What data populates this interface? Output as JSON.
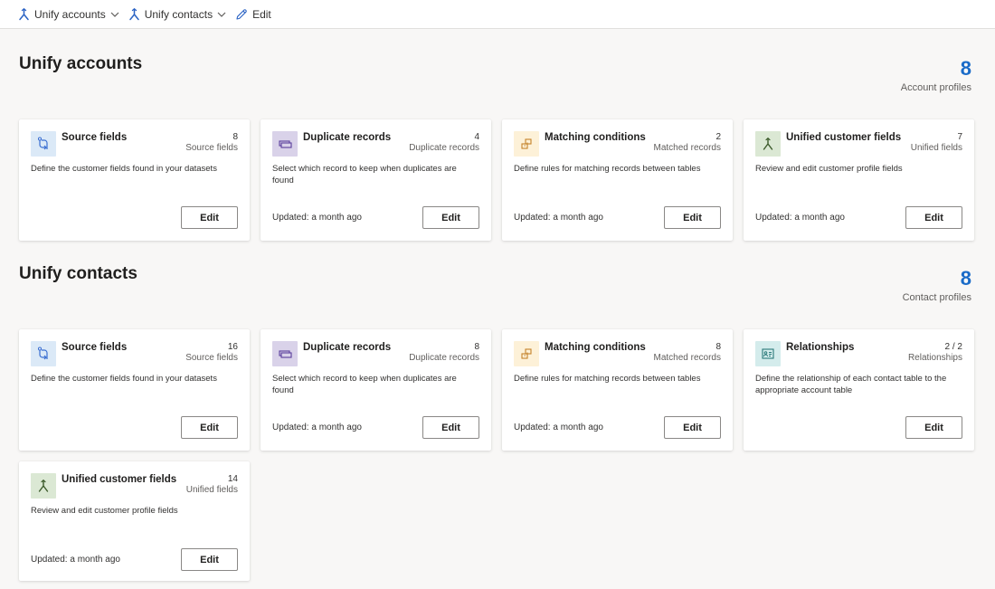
{
  "toolbar": {
    "unify_accounts": "Unify accounts",
    "unify_contacts": "Unify contacts",
    "edit": "Edit"
  },
  "accounts": {
    "title": "Unify accounts",
    "profiles_count": "8",
    "profiles_label": "Account profiles",
    "cards": [
      {
        "title": "Source fields",
        "count": "8",
        "unit": "Source fields",
        "desc": "Define the customer fields found in your datasets",
        "updated": "",
        "edit": "Edit",
        "icon": "source-fields-icon"
      },
      {
        "title": "Duplicate records",
        "count": "4",
        "unit": "Duplicate records",
        "desc": "Select which record to keep when duplicates are found",
        "updated": "Updated: a month ago",
        "edit": "Edit",
        "icon": "duplicate-records-icon"
      },
      {
        "title": "Matching conditions",
        "count": "2",
        "unit": "Matched records",
        "desc": "Define rules for matching records between tables",
        "updated": "Updated: a month ago",
        "edit": "Edit",
        "icon": "matching-conditions-icon"
      },
      {
        "title": "Unified customer fields",
        "count": "7",
        "unit": "Unified fields",
        "desc": "Review and edit customer profile fields",
        "updated": "Updated: a month ago",
        "edit": "Edit",
        "icon": "unified-fields-icon"
      }
    ]
  },
  "contacts": {
    "title": "Unify contacts",
    "profiles_count": "8",
    "profiles_label": "Contact profiles",
    "cards": [
      {
        "title": "Source fields",
        "count": "16",
        "unit": "Source fields",
        "desc": "Define the customer fields found in your datasets",
        "updated": "",
        "edit": "Edit",
        "icon": "source-fields-icon"
      },
      {
        "title": "Duplicate records",
        "count": "8",
        "unit": "Duplicate records",
        "desc": "Select which record to keep when duplicates are found",
        "updated": "Updated: a month ago",
        "edit": "Edit",
        "icon": "duplicate-records-icon"
      },
      {
        "title": "Matching conditions",
        "count": "8",
        "unit": "Matched records",
        "desc": "Define rules for matching records between tables",
        "updated": "Updated: a month ago",
        "edit": "Edit",
        "icon": "matching-conditions-icon"
      },
      {
        "title": "Relationships",
        "count": "2 / 2",
        "unit": "Relationships",
        "desc": "Define the relationship of each contact table to the appropriate account table",
        "updated": "",
        "edit": "Edit",
        "icon": "relationships-icon"
      },
      {
        "title": "Unified customer fields",
        "count": "14",
        "unit": "Unified fields",
        "desc": "Review and edit customer profile fields",
        "updated": "Updated: a month ago",
        "edit": "Edit",
        "icon": "unified-fields-icon"
      }
    ]
  },
  "colors": {
    "accent": "#1a6bc8",
    "source_icon_bg": "#dbe9f7",
    "duplicate_icon_bg": "#d9d2e9",
    "matching_icon_bg": "#fdf1d8",
    "unified_icon_bg": "#dbe8d4",
    "relationships_icon_bg": "#d4ecec"
  }
}
